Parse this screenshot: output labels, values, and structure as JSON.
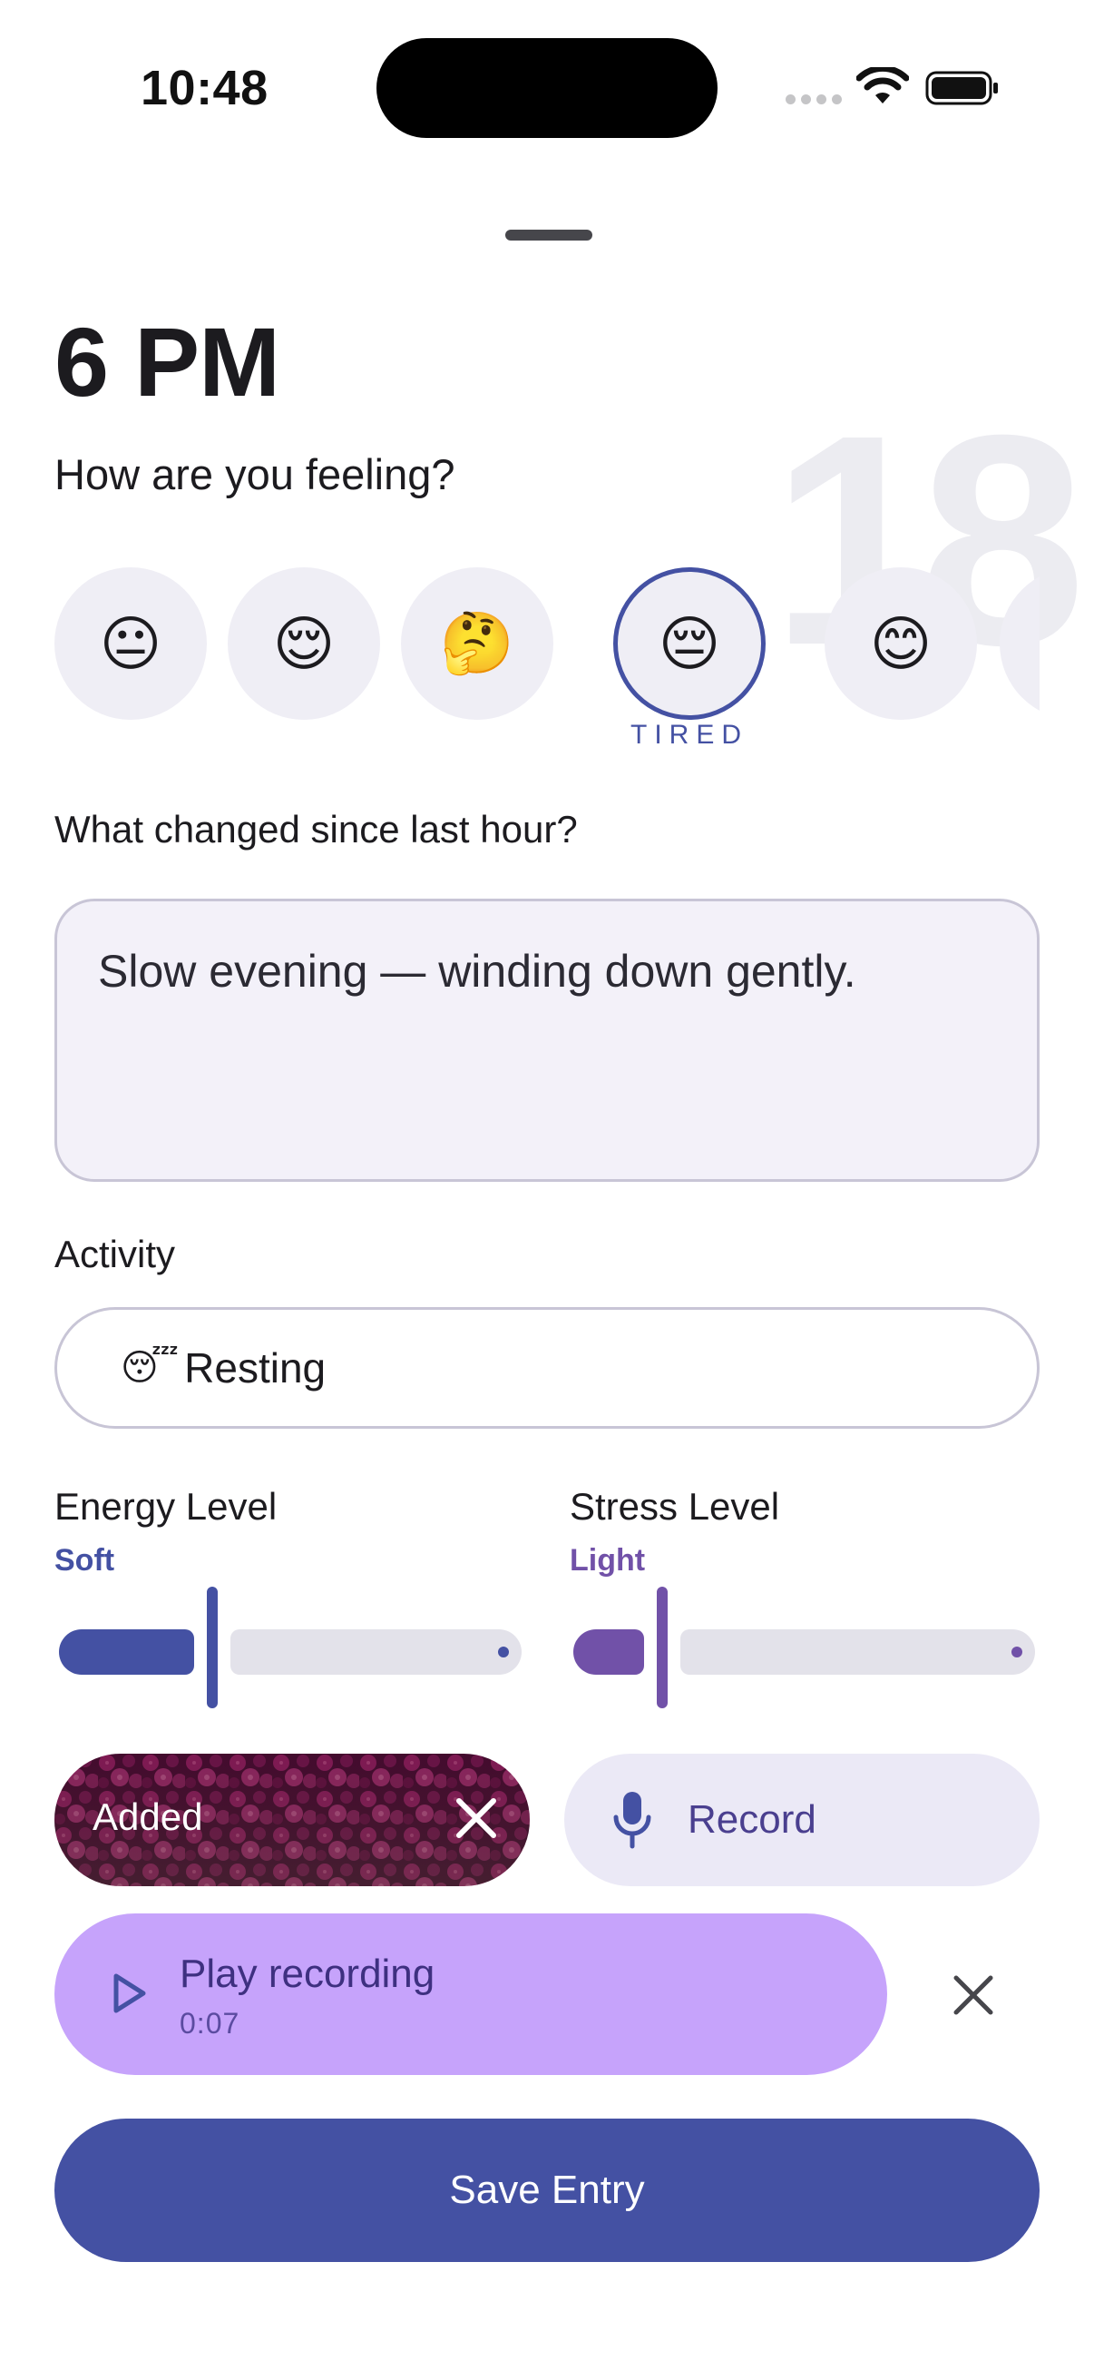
{
  "status_bar": {
    "time": "10:48"
  },
  "entry": {
    "hour_title": "6 PM",
    "hour_watermark": "18"
  },
  "mood": {
    "question": "How are you feeling?",
    "options": [
      {
        "emoji": "😐",
        "icon": "neutral-face"
      },
      {
        "emoji": "😌",
        "icon": "relieved-face"
      },
      {
        "emoji": "🤔",
        "icon": "thinking-face"
      },
      {
        "emoji": "😔",
        "icon": "pensive-face",
        "label": "TIRED",
        "selected": true
      },
      {
        "emoji": "😊",
        "icon": "smiling-face"
      }
    ]
  },
  "change": {
    "question": "What changed since last hour?",
    "text": "Slow evening — winding down gently."
  },
  "activity": {
    "label": "Activity",
    "emoji": "😴",
    "value": "Resting"
  },
  "energy": {
    "label": "Energy Level",
    "value_label": "Soft",
    "level": 0.32,
    "color": "#4451a3"
  },
  "stress": {
    "label": "Stress Level",
    "value_label": "Light",
    "level": 0.18,
    "color": "#7151a8"
  },
  "attachments": {
    "photo_label": "Added",
    "record_label": "Record"
  },
  "recording": {
    "title": "Play recording",
    "duration": "0:07"
  },
  "save": {
    "label": "Save Entry"
  },
  "colors": {
    "primary": "#4451a3",
    "recording_bg": "#c6a3fb",
    "chip_bg": "#efeef5"
  }
}
